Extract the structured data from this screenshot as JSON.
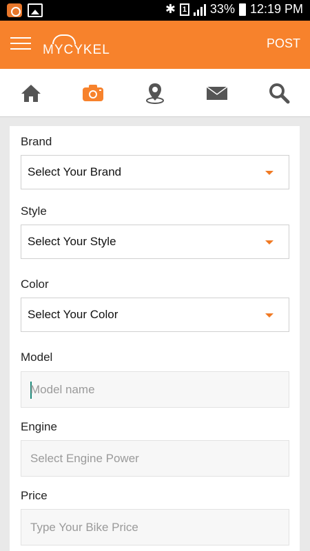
{
  "status_bar": {
    "battery": "33%",
    "time": "12:19 PM"
  },
  "app_bar": {
    "logo_my": "MY",
    "logo_cykel": "CYKEL",
    "post_label": "POST",
    "accent": "#f7822c"
  },
  "nav": {
    "items": [
      {
        "icon": "home-icon",
        "active": false
      },
      {
        "icon": "camera-icon",
        "active": true
      },
      {
        "icon": "map-pin-icon",
        "active": false
      },
      {
        "icon": "mail-icon",
        "active": false
      },
      {
        "icon": "search-icon",
        "active": false
      }
    ]
  },
  "form": {
    "brand": {
      "label": "Brand",
      "value": "Select Your Brand"
    },
    "style": {
      "label": "Style",
      "value": "Select Your Style"
    },
    "color": {
      "label": "Color",
      "value": "Select Your Color"
    },
    "model": {
      "label": "Model",
      "placeholder": "Model name"
    },
    "engine": {
      "label": "Engine",
      "placeholder": "Select Engine Power"
    },
    "price": {
      "label": "Price",
      "placeholder": "Type Your Bike Price"
    }
  }
}
